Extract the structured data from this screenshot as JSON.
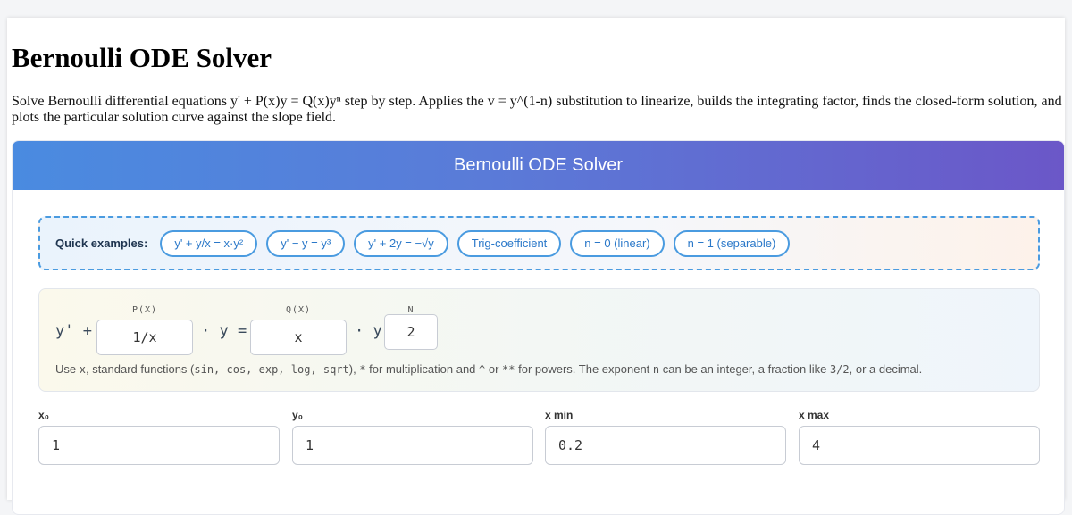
{
  "page": {
    "title": "Bernoulli ODE Solver",
    "intro": "Solve Bernoulli differential equations y' + P(x)y = Q(x)yⁿ step by step. Applies the v = y^(1-n) substitution to linearize, builds the integrating factor, finds the closed-form solution, and plots the particular solution curve against the slope field."
  },
  "card": {
    "header": "Bernoulli ODE Solver"
  },
  "examples": {
    "label": "Quick examples:",
    "items": [
      "y' + y/x = x·y²",
      "y' − y = y³",
      "y' + 2y = −√y",
      "Trig-coefficient",
      "n = 0 (linear)",
      "n = 1 (separable)"
    ]
  },
  "equation": {
    "prefix": "y' +",
    "p_caption": "P(X)",
    "p_value": "1/x",
    "mid": "· y =",
    "q_caption": "Q(X)",
    "q_value": "x",
    "suffix": "· y",
    "n_caption": "N",
    "n_value": "2",
    "hint": {
      "t1": "Use ",
      "x": "x",
      "t2": ", standard functions (",
      "fns": "sin, cos, exp, log, sqrt",
      "t3": "), ",
      "mul": "*",
      "t4": " for multiplication and ",
      "caret": "^",
      "t5": " or ",
      "pow": "**",
      "t6": " for powers. The exponent ",
      "n": "n",
      "t7": " can be an integer, a fraction like ",
      "frac": "3/2",
      "t8": ", or a decimal."
    }
  },
  "params": {
    "x0_label": "x₀",
    "x0_value": "1",
    "y0_label": "y₀",
    "y0_value": "1",
    "xmin_label": "x min",
    "xmin_value": "0.2",
    "xmax_label": "x max",
    "xmax_value": "4"
  }
}
